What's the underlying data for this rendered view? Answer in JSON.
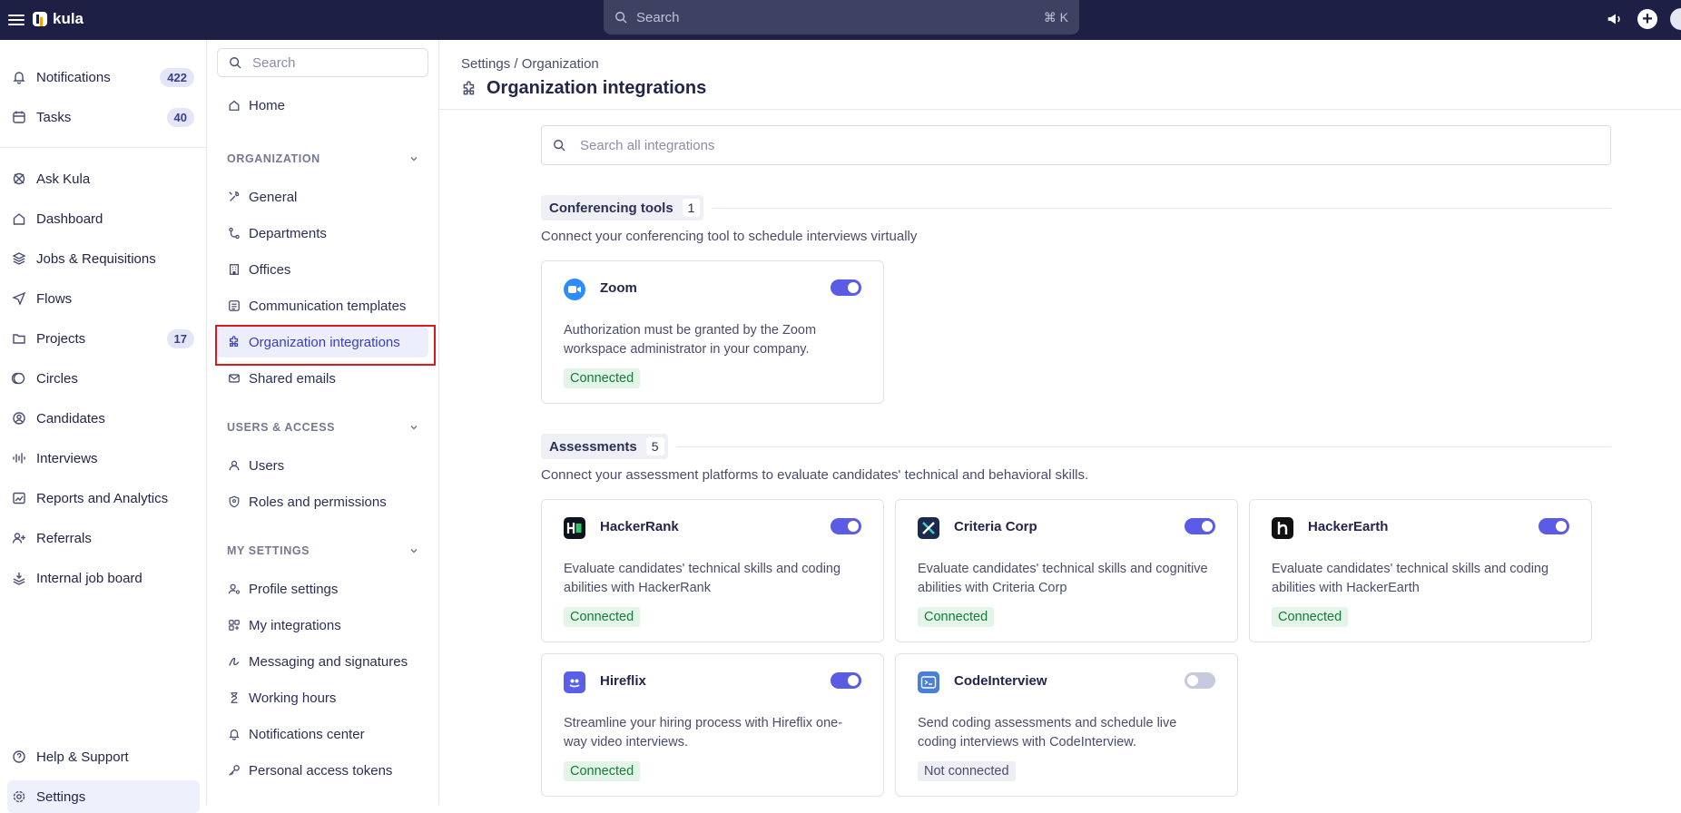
{
  "topbar": {
    "brand": "kula",
    "search_placeholder": "Search",
    "search_shortcut": "⌘ K"
  },
  "nav": {
    "items": [
      {
        "label": "Notifications",
        "count": "422"
      },
      {
        "label": "Tasks",
        "count": "40"
      },
      {
        "label": "Ask Kula"
      },
      {
        "label": "Dashboard"
      },
      {
        "label": "Jobs & Requisitions"
      },
      {
        "label": "Flows"
      },
      {
        "label": "Projects",
        "count": "17"
      },
      {
        "label": "Circles"
      },
      {
        "label": "Candidates"
      },
      {
        "label": "Interviews"
      },
      {
        "label": "Reports and Analytics"
      },
      {
        "label": "Referrals"
      },
      {
        "label": "Internal job board"
      }
    ],
    "help_label": "Help & Support",
    "settings_label": "Settings"
  },
  "subnav": {
    "search_placeholder": "Search",
    "home_label": "Home",
    "organization_heading": "ORGANIZATION",
    "organization_items": [
      "General",
      "Departments",
      "Offices",
      "Communication templates",
      "Organization integrations",
      "Shared emails"
    ],
    "users_heading": "USERS & ACCESS",
    "users_items": [
      "Users",
      "Roles and permissions"
    ],
    "my_settings_heading": "MY SETTINGS",
    "my_settings_items": [
      "Profile settings",
      "My integrations",
      "Messaging and signatures",
      "Working hours",
      "Notifications center",
      "Personal access tokens"
    ]
  },
  "main": {
    "breadcrumb": "Settings / Organization",
    "title": "Organization integrations",
    "integration_search_placeholder": "Search all integrations",
    "sections": [
      {
        "name": "Conferencing tools",
        "count": "1",
        "description": "Connect your conferencing tool to schedule interviews virtually",
        "cards": [
          {
            "name": "Zoom",
            "description": "Authorization must be granted by the Zoom workspace administrator in your company.",
            "status": "Connected",
            "enabled": true
          }
        ]
      },
      {
        "name": "Assessments",
        "count": "5",
        "description": "Connect your assessment platforms to evaluate candidates' technical and behavioral skills.",
        "cards": [
          {
            "name": "HackerRank",
            "description": "Evaluate candidates' technical skills and coding abilities with HackerRank",
            "status": "Connected",
            "enabled": true
          },
          {
            "name": "Criteria Corp",
            "description": "Evaluate candidates' technical skills and cognitive abilities with Criteria Corp",
            "status": "Connected",
            "enabled": true
          },
          {
            "name": "HackerEarth",
            "description": "Evaluate candidates' technical skills and coding abilities with HackerEarth",
            "status": "Connected",
            "enabled": true
          },
          {
            "name": "Hireflix",
            "description": "Streamline your hiring process with Hireflix one-way video interviews.",
            "status": "Connected",
            "enabled": true
          },
          {
            "name": "CodeInterview",
            "description": "Send coding assessments and schedule live coding interviews with CodeInterview.",
            "status": "Not connected",
            "enabled": false
          }
        ]
      }
    ]
  },
  "colors": {
    "topbar_bg": "#1d1f45",
    "accent": "#5a5ce6",
    "connected_bg": "#e3f5e8",
    "connected_text": "#157a3a",
    "highlight_border": "#e0191f"
  }
}
